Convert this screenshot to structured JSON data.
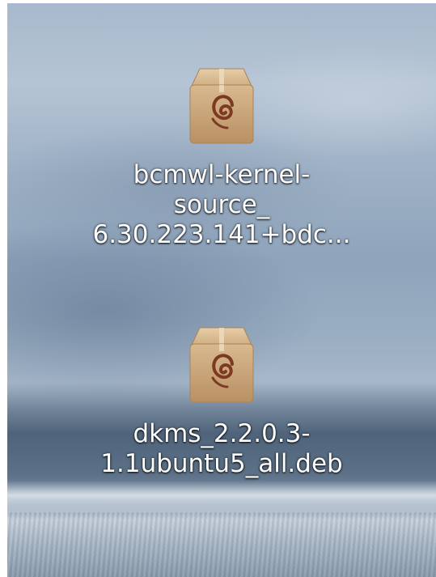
{
  "desktop": {
    "icons": [
      {
        "icon": "debian-package-icon",
        "label_lines": [
          "bcmwl-kernel-",
          "source_",
          "6.30.223.141+bdc..."
        ]
      },
      {
        "icon": "debian-package-icon",
        "label_lines": [
          "dkms_2.2.0.3-",
          "1.1ubuntu5_all.deb"
        ]
      }
    ]
  },
  "colors": {
    "label_text": "#ffffff",
    "package_box": "#c9a57a",
    "debian_swirl": "#7d3a22"
  }
}
